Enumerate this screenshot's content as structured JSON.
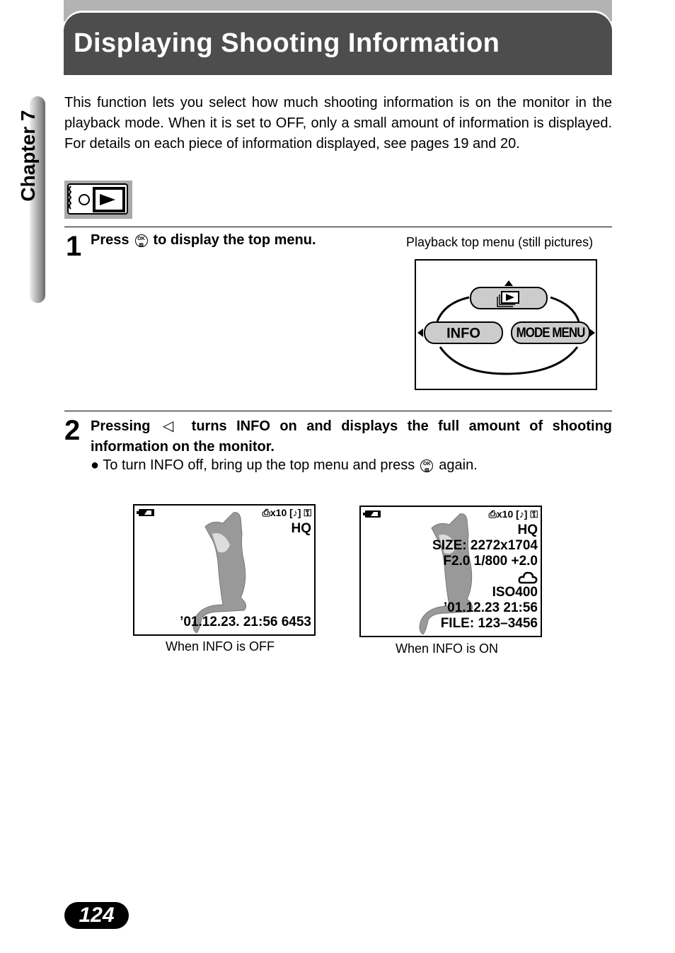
{
  "header": {
    "title": "Displaying Shooting Information"
  },
  "chapter_tab": {
    "label": "Chapter 7"
  },
  "intro": "This function lets you select how much shooting information is on the monitor in the playback mode. When it is set to OFF, only a small amount of information is displayed. For details on each piece of information displayed, see pages 19 and 20.",
  "mode_icon": "playback-mode-icon",
  "step1": {
    "number": "1",
    "text_before": "Press",
    "button_icon": "ok-button-icon",
    "text_after": "to display the top menu.",
    "figure_caption": "Playback top menu (still pictures)",
    "menu": {
      "top_item_icon": "playback-stack-icon",
      "left_item": "INFO",
      "right_item": "MODE MENU"
    }
  },
  "step2": {
    "number": "2",
    "text_before": "Pressing",
    "arrow_icon": "left-arrow-icon",
    "text_after": "turns INFO on and displays the full amount of shooting information on the monitor.",
    "bullet": {
      "text_before": "To turn INFO off, bring up the top menu and press",
      "button_icon": "ok-button-icon",
      "text_after": "again."
    }
  },
  "screens": {
    "off": {
      "top_indicators": "⎙x10 [♪] ⚿",
      "quality": "HQ",
      "bottom_line": "’01.12.23. 21:56 6453",
      "caption": "When INFO is OFF"
    },
    "on": {
      "top_indicators": "⎙x10 [♪] ⚿",
      "quality": "HQ",
      "size": "SIZE: 2272x1704",
      "exposure": "F2.0  1/800  +2.0",
      "white_balance_icon": "cloudy-icon",
      "iso": "ISO400",
      "datetime": "’01.12.23  21:56",
      "file": "FILE: 123–3456",
      "caption": "When INFO is ON"
    }
  },
  "page_number": "124"
}
